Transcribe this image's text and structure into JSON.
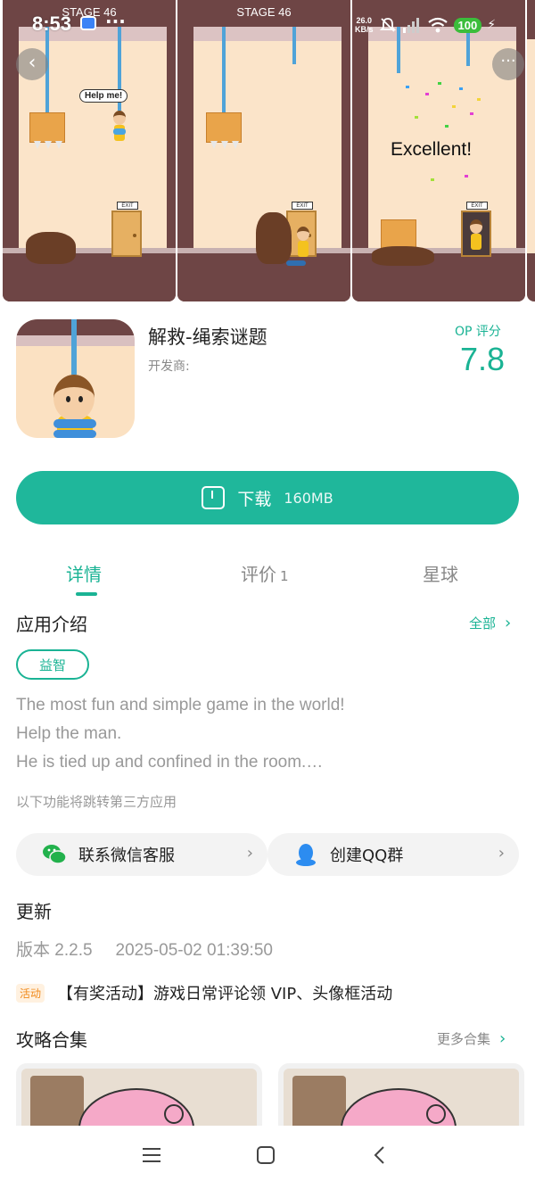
{
  "status_bar": {
    "time": "8:53",
    "net_speed_value": "26.0",
    "net_speed_unit": "KB/s",
    "battery": "100"
  },
  "gallery": {
    "screens": [
      {
        "stage": "STAGE 46",
        "bubble": "Help me!",
        "exit_sign": "EXIT"
      },
      {
        "stage": "STAGE 46",
        "exit_sign": "EXIT"
      },
      {
        "exit_sign": "EXIT",
        "caption": "Excellent!"
      }
    ]
  },
  "app": {
    "title": "解救-绳索谜题",
    "developer": "开发商:",
    "op_label": "OP 评分",
    "op_score": "7.8"
  },
  "download": {
    "label": "下载",
    "size": "160MB"
  },
  "tabs": [
    {
      "label": "详情",
      "count": ""
    },
    {
      "label": "评价",
      "count": "1"
    },
    {
      "label": "星球",
      "count": ""
    }
  ],
  "intro": {
    "title": "应用介绍",
    "all_link": "全部",
    "tag": "益智",
    "lines": [
      "The most fun and simple game in the world!",
      "Help the man.",
      "He is tied up and confined in the room.…"
    ],
    "third_party_notice": "以下功能将跳转第三方应用",
    "wechat_label": "联系微信客服",
    "qq_label": "创建QQ群"
  },
  "update": {
    "title": "更新",
    "version": "版本 2.2.5",
    "date": "2025-05-02 01:39:50",
    "event_badge": "活动",
    "event_text": "【有奖活动】游戏日常评论领 VIP、头像框活动"
  },
  "guides": {
    "title": "攻略合集",
    "more_link": "更多合集"
  },
  "colors": {
    "accent": "#1fb79b",
    "frame": "#6e4545"
  },
  "icons": {
    "back": "chevron-left-icon",
    "more": "more-dots-icon",
    "download": "download-icon",
    "wechat": "wechat-icon",
    "qq": "qq-icon",
    "nav": [
      "menu-icon",
      "home-icon",
      "back-icon"
    ]
  }
}
